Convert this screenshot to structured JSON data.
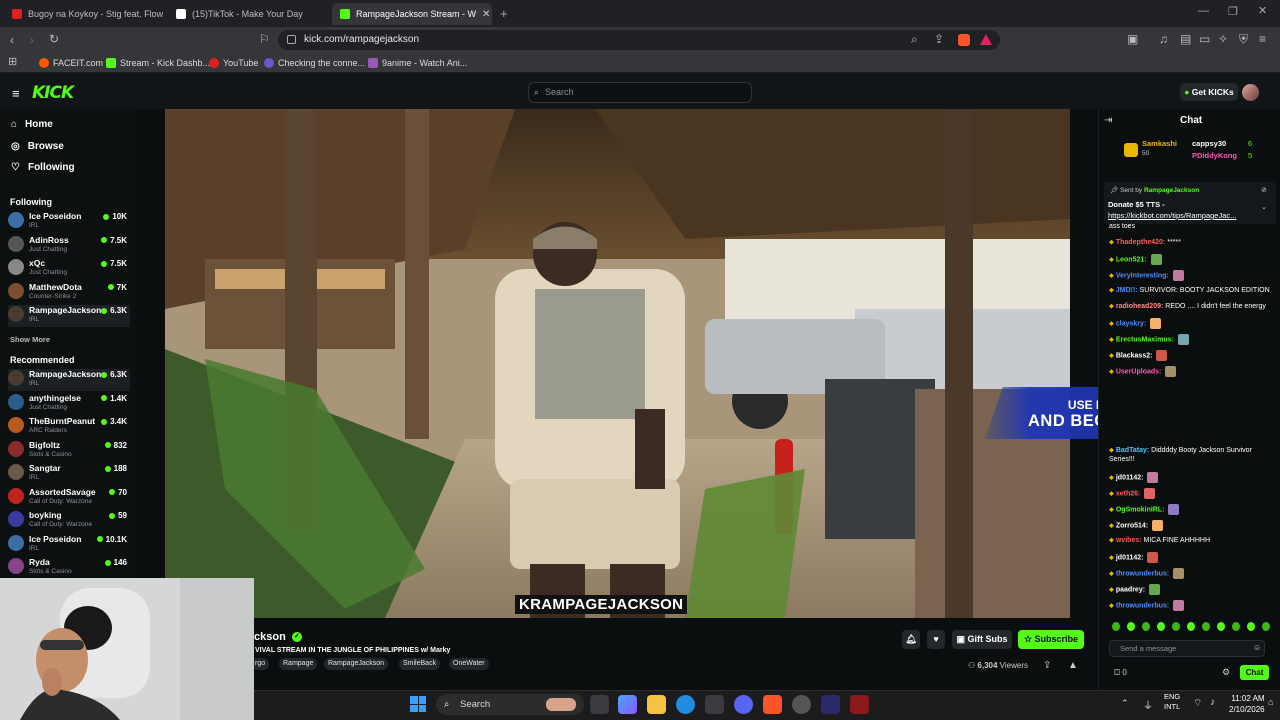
{
  "browser": {
    "tabs": [
      {
        "title": "Bugoy na Koykoy - Stig feat. Flow G",
        "favicon_color": "#e02020"
      },
      {
        "title": "(15)TikTok - Make Your Day",
        "favicon_color": "#ffffff"
      },
      {
        "title": "RampageJackson Stream - W",
        "favicon_color": "#53fc18"
      }
    ],
    "url": "kick.com/rampagejackson",
    "bookmarks": [
      {
        "label": "FACEIT.com",
        "color": "#ff5500"
      },
      {
        "label": "Stream - Kick Dashb...",
        "color": "#53fc18"
      },
      {
        "label": "YouTube",
        "color": "#e02020"
      },
      {
        "label": "Checking the conne...",
        "color": "#6a5acd"
      },
      {
        "label": "9anime - Watch Ani...",
        "color": "#9b59b6"
      }
    ]
  },
  "kick": {
    "logo": "KICK",
    "search_placeholder": "Search",
    "get_kicks": "Get KICKs",
    "accent": "#53fc18"
  },
  "sidebar": {
    "nav": [
      {
        "label": "Home",
        "icon": "home-icon"
      },
      {
        "label": "Browse",
        "icon": "compass-icon"
      },
      {
        "label": "Following",
        "icon": "heart-icon"
      }
    ],
    "following_title": "Following",
    "following": [
      {
        "name": "Ice Poseidon",
        "category": "IRL",
        "viewers": "10K",
        "color": "#3a6ea5"
      },
      {
        "name": "AdinRoss",
        "category": "Just Chatting",
        "viewers": "7.5K",
        "color": "#555"
      },
      {
        "name": "xQc",
        "category": "Just Chatting",
        "viewers": "7.5K",
        "color": "#888"
      },
      {
        "name": "MatthewDota",
        "category": "Counter-Strike 2",
        "viewers": "7K",
        "color": "#7a4e2e"
      },
      {
        "name": "RampageJackson",
        "category": "IRL",
        "viewers": "6.3K",
        "color": "#4b3a2e"
      }
    ],
    "show_more": "Show More",
    "recommended_title": "Recommended",
    "recommended": [
      {
        "name": "RampageJackson",
        "category": "IRL",
        "viewers": "6.3K",
        "color": "#4b3a2e"
      },
      {
        "name": "anythingelse",
        "category": "Just Chatting",
        "viewers": "1.4K",
        "color": "#2a5d8a"
      },
      {
        "name": "TheBurntPeanut",
        "category": "ARC Raiders",
        "viewers": "3.4K",
        "color": "#b85b20"
      },
      {
        "name": "Bigfoltz",
        "category": "Slots & Casino",
        "viewers": "832",
        "color": "#8a2a2a"
      },
      {
        "name": "Sangtar",
        "category": "IRL",
        "viewers": "188",
        "color": "#6a5a4a"
      },
      {
        "name": "AssortedSavage",
        "category": "Call of Duty: Warzone",
        "viewers": "70",
        "color": "#c02020"
      },
      {
        "name": "boyking",
        "category": "Call of Duty: Warzone",
        "viewers": "59",
        "color": "#3a3aa0"
      },
      {
        "name": "Ice Poseidon",
        "category": "IRL",
        "viewers": "10.1K",
        "color": "#3a6ea5"
      },
      {
        "name": "Ryda",
        "category": "Slots & Casino",
        "viewers": "146",
        "color": "#884488"
      }
    ]
  },
  "video": {
    "promo_line1": "USE MY PROMOCODE",
    "promo_line2": "AND BECOME A WINNER",
    "watermark": "KRAMPAGEJACKSON"
  },
  "stream": {
    "streamer": "ckson",
    "title": "VIVAL STREAM IN THE JUNGLE OF PHILIPPINES w/ Marky",
    "tags": [
      "rgo",
      "Rampage",
      "RampageJackson",
      "SmileBack",
      "OneWater"
    ],
    "gift_subs": "Gift Subs",
    "subscribe": "Subscribe",
    "viewers": "6,304",
    "viewers_label": "Viewers"
  },
  "chat": {
    "title": "Chat",
    "top_gifters": [
      {
        "name": "Samkashi",
        "count": "50"
      },
      {
        "name": "cappsy30",
        "count": "6"
      },
      {
        "name": "PDiddyKong",
        "count": "5"
      }
    ],
    "pinned_sent_by": "Sent by",
    "pinned_user": "RampageJackson",
    "pinned_text": "Donate $5 TTS -",
    "pinned_link": "https://kickbot.com/tips/RampageJac...",
    "messages": [
      {
        "user": "",
        "text": "ass toes",
        "color": "#cccccc"
      },
      {
        "user": "Thadepthe420:",
        "text": "*****",
        "color": "#ff5a5a"
      },
      {
        "user": "Leon521:",
        "text": "",
        "color": "#53fc18"
      },
      {
        "user": "VeryInteresting:",
        "text": "",
        "color": "#4f8cff"
      },
      {
        "user": "JMD!!:",
        "text": "SURVIVOR: BOOTY JACKSON EDITION",
        "color": "#4f8cff"
      },
      {
        "user": "radiohead209:",
        "text": "REDO .... I didn't feel the energy",
        "color": "#ff8a8a"
      },
      {
        "user": "clayskry:",
        "text": "",
        "color": "#4f8cff"
      },
      {
        "user": "ErectusMaximus:",
        "text": "",
        "color": "#53fc18"
      },
      {
        "user": "Blackass2:",
        "text": "",
        "color": "#ffffff"
      },
      {
        "user": "UserUploads:",
        "text": "",
        "color": "#ff5ab4"
      },
      {
        "user": "BadTatay:",
        "text": "Diddddy Booty Jackson Survivor Series!!!",
        "color": "#4fc3ff"
      },
      {
        "user": "jd01142:",
        "text": "",
        "color": "#ffffff"
      },
      {
        "user": "xeth26:",
        "text": "",
        "color": "#ff5a5a"
      },
      {
        "user": "OgSmokinIRL:",
        "text": "",
        "color": "#53fc18"
      },
      {
        "user": "Zorro514:",
        "text": "",
        "color": "#ffffff"
      },
      {
        "user": "wvibes:",
        "text": "MICA FINE AHHHHH",
        "color": "#ff5a5a"
      },
      {
        "user": "jd01142:",
        "text": "",
        "color": "#ffffff"
      },
      {
        "user": "throwunderbus:",
        "text": "",
        "color": "#4f8cff"
      },
      {
        "user": "paadrey:",
        "text": "",
        "color": "#ffffff"
      },
      {
        "user": "throwunderbus:",
        "text": "",
        "color": "#4f8cff"
      }
    ],
    "input_placeholder": "Send a message",
    "points": "0",
    "send_label": "Chat"
  },
  "taskbar": {
    "search": "Search",
    "lang1": "ENG",
    "lang2": "INTL",
    "time": "11:02 AM",
    "date": "2/10/2026"
  }
}
